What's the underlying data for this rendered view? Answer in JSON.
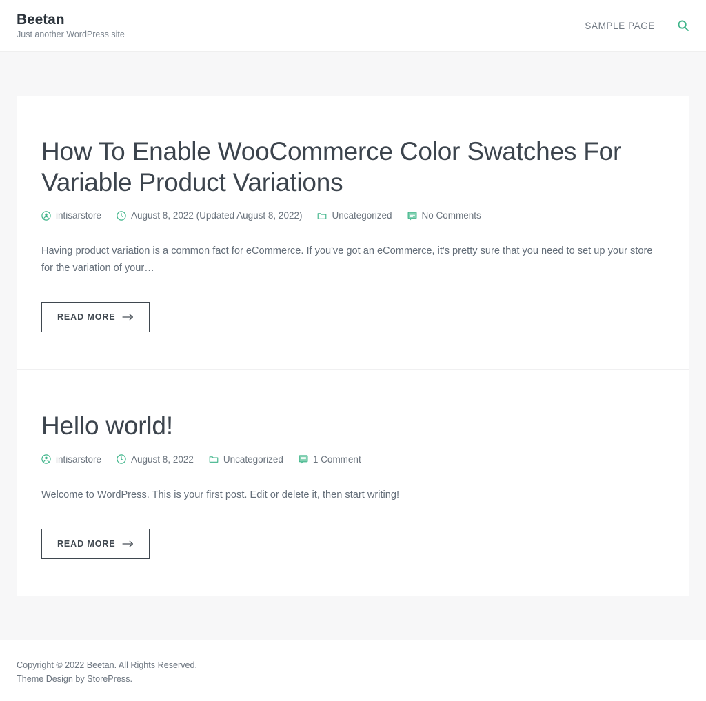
{
  "header": {
    "site_title": "Beetan",
    "tagline": "Just another WordPress site",
    "nav": [
      {
        "label": "SAMPLE PAGE",
        "name": "nav-link-sample-page"
      }
    ],
    "search_icon": "search-icon",
    "accent_color": "#3eb489"
  },
  "posts": [
    {
      "title": "How To Enable WooCommerce Color Swatches For Variable Product Variations",
      "author": "intisarstore",
      "date": "August 8, 2022 (Updated August 8, 2022)",
      "category": "Uncategorized",
      "comments": "No Comments",
      "excerpt": "Having product variation is a common fact for eCommerce. If you've got an eCommerce, it's pretty sure that you need to set up your store for the variation of your…",
      "read_more": "READ MORE"
    },
    {
      "title": "Hello world!",
      "author": "intisarstore",
      "date": "August 8, 2022",
      "category": "Uncategorized",
      "comments": "1 Comment",
      "excerpt": "Welcome to WordPress. This is your first post. Edit or delete it, then start writing!",
      "read_more": "READ MORE"
    }
  ],
  "footer": {
    "copyright": "Copyright © 2022 Beetan. All Rights Reserved.",
    "credit_prefix": "Theme Design by ",
    "credit_link": "StorePress",
    "credit_suffix": "."
  }
}
